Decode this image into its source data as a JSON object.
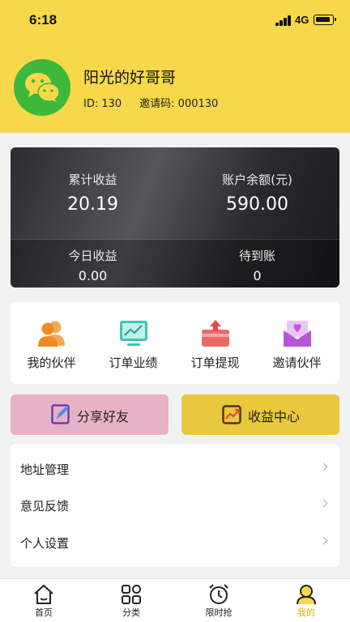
{
  "status": {
    "time": "6:18",
    "network": "4G"
  },
  "profile": {
    "name": "阳光的好哥哥",
    "id": "ID: 130",
    "invite": "邀请码: 000130"
  },
  "earnings": {
    "total_label": "累计收益",
    "total_value": "20.19",
    "balance_label": "账户余额(元)",
    "balance_value": "590.00",
    "today_label": "今日收益",
    "today_value": "0.00",
    "pending_label": "待到账",
    "pending_value": "0"
  },
  "quick": {
    "partners": "我的伙伴",
    "performance": "订单业绩",
    "withdraw": "订单提现",
    "invite": "邀请伙伴"
  },
  "buttons": {
    "share": "分享好友",
    "income": "收益中心"
  },
  "menu": {
    "address": "地址管理",
    "feedback": "意见反馈",
    "settings": "个人设置"
  },
  "tabs": {
    "home": "首页",
    "category": "分类",
    "flash": "限时抢",
    "mine": "我的"
  },
  "colors": {
    "brand_yellow": "#f7d84a",
    "active_tab": "#e0b200",
    "wechat_green": "#3db83c"
  }
}
